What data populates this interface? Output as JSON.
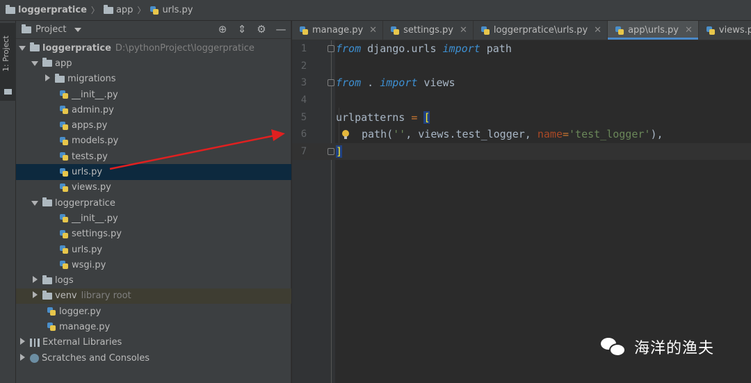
{
  "breadcrumb": {
    "items": [
      "loggerpratice",
      "app",
      "urls.py"
    ]
  },
  "toolstrip": {
    "label": "1: Project"
  },
  "project_panel": {
    "title": "Project",
    "icons": [
      "target-icon",
      "collapse-icon",
      "gear-icon",
      "minimize-icon"
    ],
    "tree": [
      {
        "label": "loggerpratice",
        "hint": "D:\\pythonProject\\loggerpratice"
      },
      {
        "label": "app"
      },
      {
        "label": "migrations"
      },
      {
        "label": "__init__.py"
      },
      {
        "label": "admin.py"
      },
      {
        "label": "apps.py"
      },
      {
        "label": "models.py"
      },
      {
        "label": "tests.py"
      },
      {
        "label": "urls.py"
      },
      {
        "label": "views.py"
      },
      {
        "label": "loggerpratice"
      },
      {
        "label": "__init__.py"
      },
      {
        "label": "settings.py"
      },
      {
        "label": "urls.py"
      },
      {
        "label": "wsgi.py"
      },
      {
        "label": "logs"
      },
      {
        "label": "venv",
        "hint": "library root"
      },
      {
        "label": "logger.py"
      },
      {
        "label": "manage.py"
      },
      {
        "label": "External Libraries"
      },
      {
        "label": "Scratches and Consoles"
      }
    ]
  },
  "tabs": [
    {
      "label": "manage.py",
      "active": false
    },
    {
      "label": "settings.py",
      "active": false
    },
    {
      "label": "loggerpratice\\urls.py",
      "active": false
    },
    {
      "label": "app\\urls.py",
      "active": true
    },
    {
      "label": "views.py",
      "active": false
    }
  ],
  "editor": {
    "line_numbers": [
      "1",
      "2",
      "3",
      "4",
      "5",
      "6",
      "7"
    ],
    "line1": {
      "kw1": "from",
      "mod": " django.urls ",
      "kw2": "import",
      "name": " path"
    },
    "line3": {
      "kw1": "from",
      "mod": " . ",
      "kw2": "import",
      "name": " views"
    },
    "line5": {
      "name": "urlpatterns ",
      "op": "=",
      "space": " ",
      "bracket": "["
    },
    "line6": {
      "fn": "path(",
      "str1": "''",
      "mid": ", views.test_logger, ",
      "param": "name",
      "eq": "=",
      "str2": "'test_logger'",
      "end": "),"
    },
    "line7": {
      "bracket": "]"
    }
  },
  "watermark": {
    "text": "海洋的渔夫"
  },
  "colors": {
    "annotation_arrow": "#e02020",
    "selection": "#0d293e",
    "keyword": "#cc7832",
    "string": "#6a8759"
  }
}
